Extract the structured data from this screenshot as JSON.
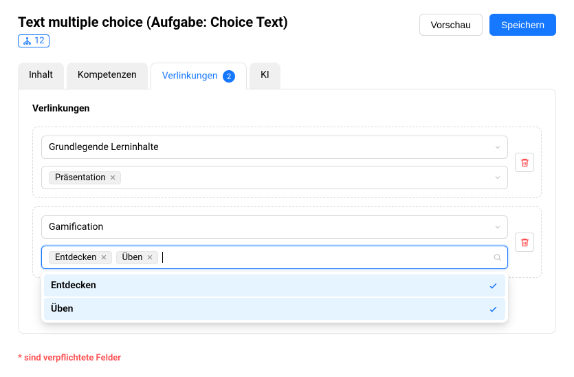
{
  "header": {
    "title": "Text multiple choice (Aufgabe: Choice Text)",
    "badge_count": "12",
    "preview_label": "Vorschau",
    "save_label": "Speichern"
  },
  "tabs": {
    "content": "Inhalt",
    "competencies": "Kompetenzen",
    "links": "Verlinkungen",
    "links_count": "2",
    "ai": "KI"
  },
  "panel": {
    "title": "Verlinkungen"
  },
  "group1": {
    "category": "Grundlegende Lerninhalte",
    "tag1": "Präsentation"
  },
  "group2": {
    "category": "Gamification",
    "tag1": "Entdecken",
    "tag2": "Üben"
  },
  "dropdown": {
    "opt1": "Entdecken",
    "opt2": "Üben"
  },
  "footer": {
    "required": "* sind verpflichtete Felder"
  }
}
